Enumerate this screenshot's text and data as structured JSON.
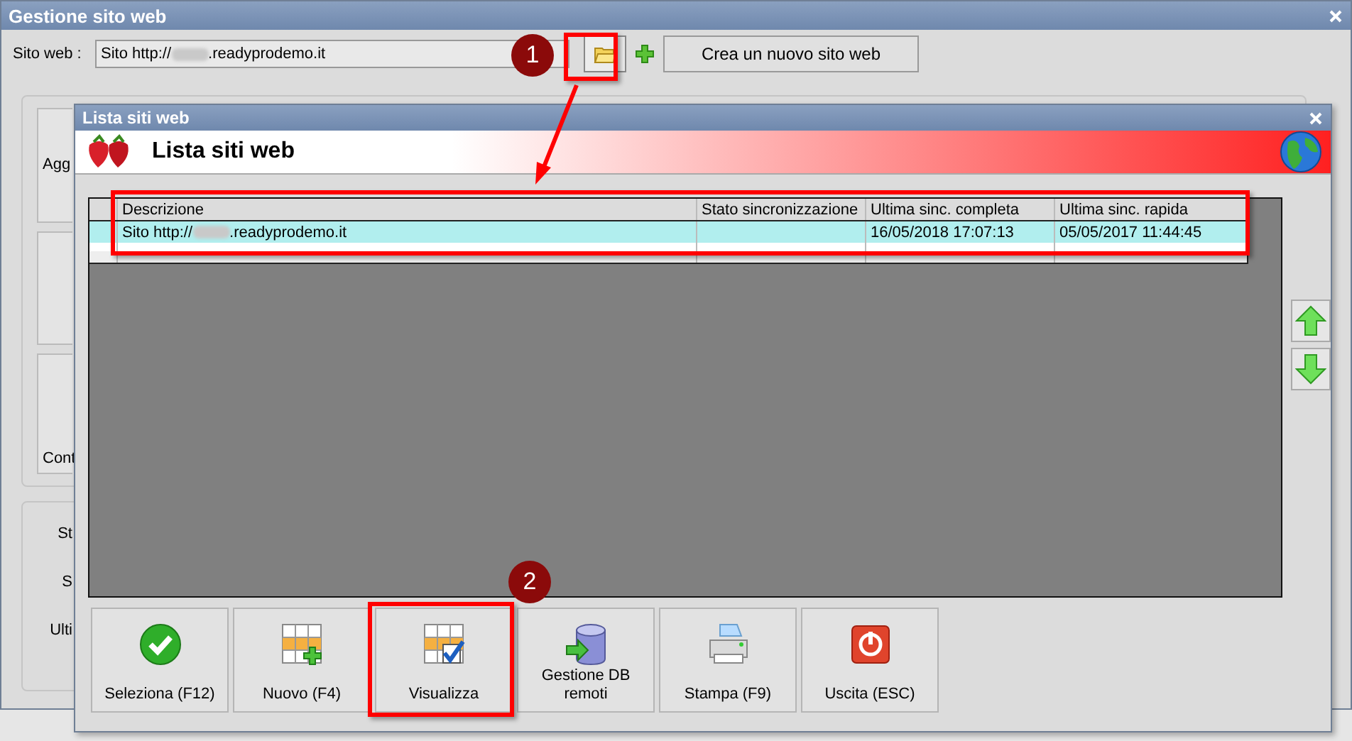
{
  "main_window": {
    "title": "Gestione sito web",
    "site_field": {
      "label": "Sito web :",
      "value_start": "Sito http://",
      "value_end": ".readyprodemo.it",
      "redacted": true
    },
    "new_site_button": "Crea un nuovo sito web",
    "panel_buttons": [
      {
        "kind": "middle",
        "label": "Agg"
      },
      {
        "kind": "blank"
      },
      {
        "kind": "bottom",
        "label": "Cont"
      }
    ],
    "status_labels": [
      "St",
      "S",
      "Ulti"
    ]
  },
  "dialog": {
    "title": "Lista siti web",
    "header": "Lista siti web",
    "table": {
      "columns": [
        "Descrizione",
        "Stato sincronizzazione",
        "Ultima sinc. completa",
        "Ultima sinc. rapida"
      ],
      "rows": [
        {
          "description_start": "Sito http://",
          "description_end": ".readyprodemo.it",
          "redacted": true,
          "full_sync": "16/05/2018 17:07:13",
          "quick_sync": "05/05/2017 11:44:45",
          "selected": true
        }
      ]
    },
    "buttons": [
      {
        "kind": "select",
        "label": "Seleziona (F12)"
      },
      {
        "kind": "new",
        "label": "Nuovo (F4)"
      },
      {
        "kind": "view",
        "label": "Visualizza"
      },
      {
        "kind": "database",
        "label": "Gestione DB remoti"
      },
      {
        "kind": "print",
        "label": "Stampa (F9)"
      },
      {
        "kind": "exit",
        "label": "Uscita (ESC)"
      }
    ]
  },
  "annotations": [
    {
      "label": "1"
    },
    {
      "label": "2"
    }
  ]
}
